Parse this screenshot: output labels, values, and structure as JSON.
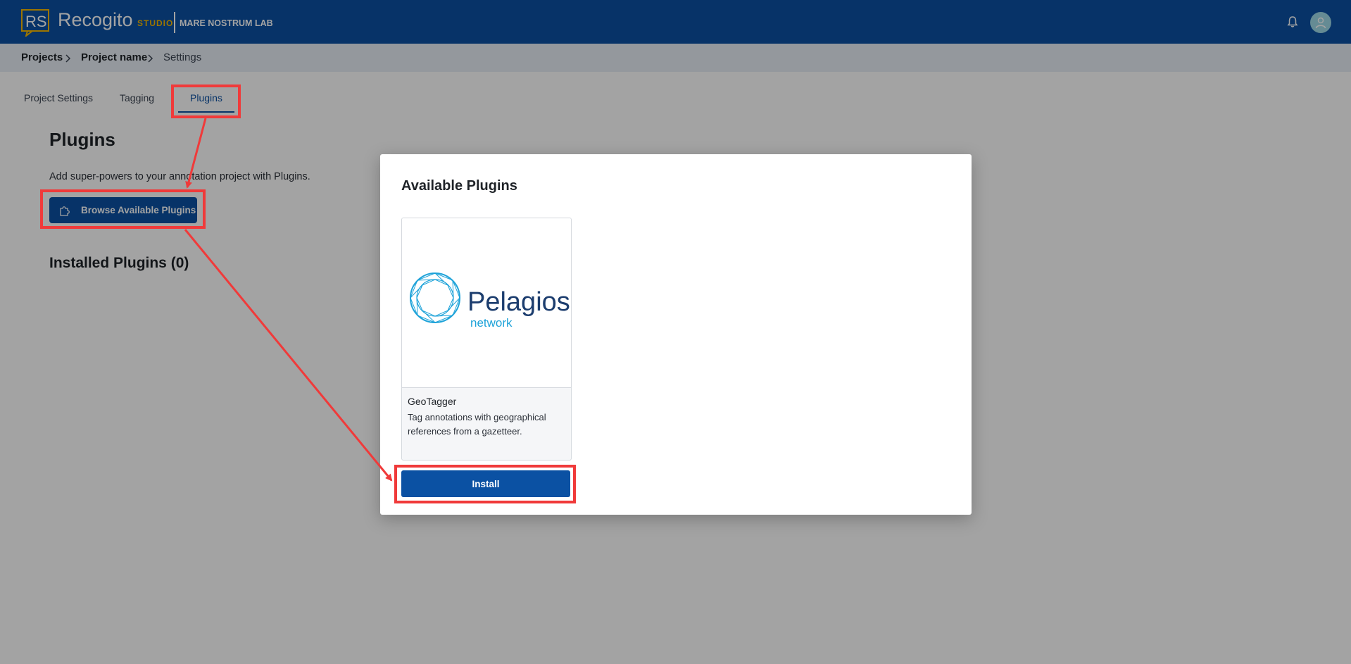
{
  "app": {
    "brand_logo_text": "RS",
    "brand_name": "Recogito",
    "brand_suffix": "STUDIO",
    "organization": "MARE NOSTRUM LAB"
  },
  "breadcrumb": [
    "Projects",
    "Project name",
    "Settings"
  ],
  "tabs": [
    {
      "label": "Project Settings",
      "active": false
    },
    {
      "label": "Tagging",
      "active": false
    },
    {
      "label": "Plugins",
      "active": true
    }
  ],
  "page": {
    "title": "Plugins",
    "description": "Add super-powers to your annotation project with Plugins.",
    "browse_button": "Browse Available Plugins",
    "installed_heading": "Installed Plugins (0)"
  },
  "modal": {
    "title": "Available Plugins",
    "plugins": [
      {
        "logo_word": "Pelagios",
        "logo_sub": "network",
        "name": "GeoTagger",
        "description": "Tag annotations with geographical references from a gazetteer.",
        "install_label": "Install"
      }
    ]
  },
  "colors": {
    "primary": "#0b51a3",
    "accent": "#f5b800",
    "annotation": "#f03a3a",
    "avatar": "#9fd9e8"
  },
  "icons": [
    "recogito-logo-icon",
    "bell-icon",
    "user-icon",
    "chevron-right-icon",
    "puzzle-icon"
  ]
}
